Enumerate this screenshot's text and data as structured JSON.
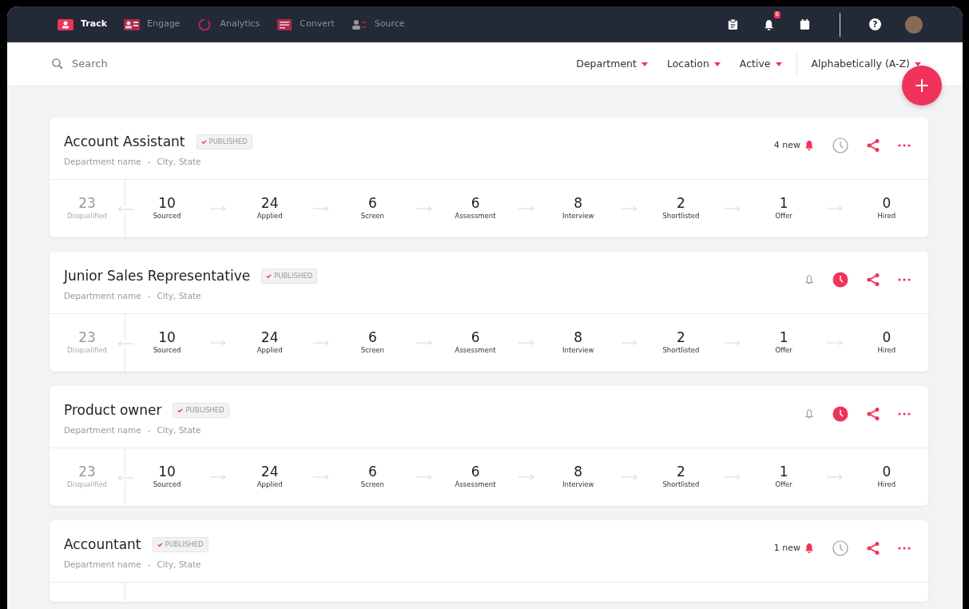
{
  "nav": {
    "tabs": [
      {
        "label": "Track",
        "selected": true
      },
      {
        "label": "Engage",
        "selected": false
      },
      {
        "label": "Analytics",
        "selected": false
      },
      {
        "label": "Convert",
        "selected": false
      },
      {
        "label": "Source",
        "selected": false
      }
    ],
    "notification_count": "6",
    "help": "?"
  },
  "filters": {
    "search": {
      "placeholder": "Search"
    },
    "dropdowns": [
      "Department",
      "Location",
      "Active"
    ],
    "sort": "Alphabetically (A-Z)",
    "add_button": "+"
  },
  "jobs": [
    {
      "title": "Account Assistant",
      "status": "PUBLISHED",
      "department": "Department name",
      "separator": "-",
      "location": "City, State",
      "alerts": "4 new",
      "scheduled": false,
      "disqualified": {
        "count": "23",
        "label": "Disqualified"
      },
      "stages": [
        {
          "count": "10",
          "label": "Sourced"
        },
        {
          "count": "24",
          "label": "Applied"
        },
        {
          "count": "6",
          "label": "Screen"
        },
        {
          "count": "6",
          "label": "Assessment"
        },
        {
          "count": "8",
          "label": "Interview"
        },
        {
          "count": "2",
          "label": "Shortlisted"
        },
        {
          "count": "1",
          "label": "Offer"
        },
        {
          "count": "0",
          "label": "Hired"
        }
      ]
    },
    {
      "title": "Junior Sales Representative",
      "status": "PUBLISHED",
      "department": "Department name",
      "separator": "-",
      "location": "City, State",
      "scheduled": true,
      "disqualified": {
        "count": "23",
        "label": "Disqualified"
      },
      "stages": [
        {
          "count": "10",
          "label": "Sourced"
        },
        {
          "count": "24",
          "label": "Applied"
        },
        {
          "count": "6",
          "label": "Screen"
        },
        {
          "count": "6",
          "label": "Assessment"
        },
        {
          "count": "8",
          "label": "Interview"
        },
        {
          "count": "2",
          "label": "Shortlisted"
        },
        {
          "count": "1",
          "label": "Offer"
        },
        {
          "count": "0",
          "label": "Hired"
        }
      ]
    },
    {
      "title": "Product owner",
      "status": "PUBLISHED",
      "department": "Department name",
      "separator": "-",
      "location": "City, State",
      "scheduled": true,
      "disqualified": {
        "count": "23",
        "label": "Disqualified"
      },
      "stages": [
        {
          "count": "10",
          "label": "Sourced"
        },
        {
          "count": "24",
          "label": "Applied"
        },
        {
          "count": "6",
          "label": "Screen"
        },
        {
          "count": "6",
          "label": "Assessment"
        },
        {
          "count": "8",
          "label": "Interview"
        },
        {
          "count": "2",
          "label": "Shortlisted"
        },
        {
          "count": "1",
          "label": "Offer"
        },
        {
          "count": "0",
          "label": "Hired"
        }
      ]
    },
    {
      "title": "Accountant",
      "status": "PUBLISHED",
      "department": "Department name",
      "separator": "-",
      "location": "City, State",
      "alerts": "1 new",
      "scheduled": false
    }
  ]
}
